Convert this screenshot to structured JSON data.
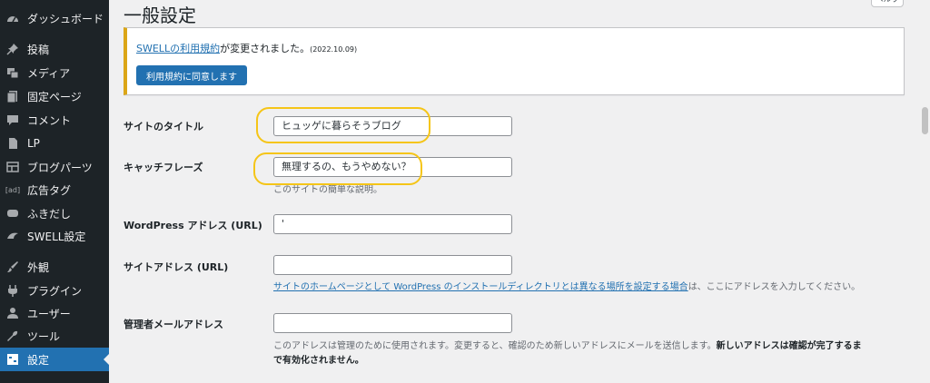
{
  "sidebar": {
    "items": [
      {
        "label": "ダッシュボード",
        "icon": "dashboard-icon",
        "active": false
      },
      {
        "label": "投稿",
        "icon": "pushpin-icon",
        "active": false
      },
      {
        "label": "メディア",
        "icon": "media-icon",
        "active": false
      },
      {
        "label": "固定ページ",
        "icon": "page-icon",
        "active": false
      },
      {
        "label": "コメント",
        "icon": "comment-icon",
        "active": false
      },
      {
        "label": "LP",
        "icon": "lp-icon",
        "active": false
      },
      {
        "label": "ブログパーツ",
        "icon": "blog-parts-icon",
        "active": false
      },
      {
        "label": "広告タグ",
        "icon": "ad-icon",
        "active": false
      },
      {
        "label": "ふきだし",
        "icon": "speech-bubble-icon",
        "active": false
      },
      {
        "label": "SWELL設定",
        "icon": "swell-icon",
        "active": false
      },
      {
        "label": "外観",
        "icon": "brush-icon",
        "active": false
      },
      {
        "label": "プラグイン",
        "icon": "plugin-icon",
        "active": false
      },
      {
        "label": "ユーザー",
        "icon": "user-icon",
        "active": false
      },
      {
        "label": "ツール",
        "icon": "wrench-icon",
        "active": false
      },
      {
        "label": "設定",
        "icon": "settings-icon",
        "active": true
      }
    ]
  },
  "page": {
    "title": "一般設定",
    "help_label": "ヘルプ"
  },
  "notice": {
    "link_text": "SWELLの利用規約",
    "text": "が変更されました。",
    "date": "(2022.10.09)",
    "button": "利用規約に同意します"
  },
  "form": {
    "site_title": {
      "label": "サイトのタイトル",
      "value": "ヒュッゲに暮らそうブログ"
    },
    "tagline": {
      "label": "キャッチフレーズ",
      "value": "無理するの、もうやめない？",
      "description": "このサイトの簡単な説明。"
    },
    "wp_address": {
      "label": "WordPress アドレス (URL)",
      "value": "'"
    },
    "site_address": {
      "label": "サイトアドレス (URL)",
      "value": "",
      "desc_link": "サイトのホームページとして WordPress のインストールディレクトリとは異なる場所を設定する場合",
      "desc_text": "は、ここにアドレスを入力してください。"
    },
    "admin_email": {
      "label": "管理者メールアドレス",
      "value": "",
      "desc_line1_plain": "このアドレスは管理のために使用されます。変更すると、確認のため新しいアドレスにメールを送信します。",
      "desc_line1_bold": "新しいアドレスは確認が完了するま",
      "desc_line2_bold": "で有効化されません。"
    }
  },
  "colors": {
    "sidebar_bg": "#1d2327",
    "accent": "#2271b1",
    "notice_border": "#dba617",
    "highlight": "#f5c518"
  }
}
